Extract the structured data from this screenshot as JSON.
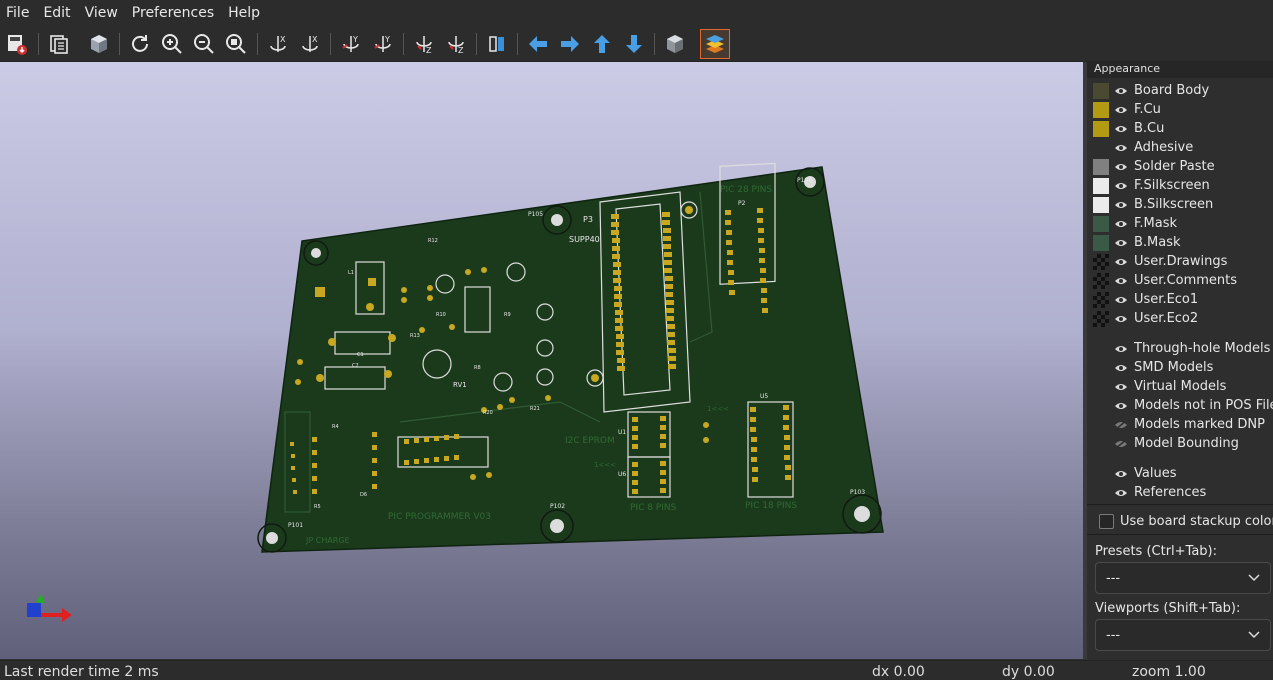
{
  "menu": [
    "File",
    "Edit",
    "View",
    "Preferences",
    "Help"
  ],
  "toolbar": {
    "icons": [
      "export-icon",
      "copy-image-icon",
      "raytrace-icon",
      "reload-icon",
      "zoom-in-icon",
      "zoom-out-icon",
      "zoom-fit-icon",
      "rotate-x-cw-icon",
      "rotate-x-ccw-icon",
      "rotate-y-cw-icon",
      "rotate-y-ccw-icon",
      "rotate-z-cw-icon",
      "rotate-z-ccw-icon",
      "flip-board-icon",
      "move-left-icon",
      "move-right-icon",
      "move-up-icon",
      "move-down-icon",
      "ortho-icon",
      "layers-manager-icon"
    ]
  },
  "board": {
    "labels": [
      "P3",
      "SUPP40",
      "PIC 28 PINS",
      "P104",
      "P105",
      "P101",
      "P102",
      "P103",
      "RV1",
      "U1",
      "U6",
      "U5",
      "PIC 8 PINS",
      "PIC 18 PINS",
      "I2C EPROM",
      "PIC PROGRAMMER V03",
      "JP CHARGE",
      "P2",
      "R12",
      "R10",
      "R13",
      "R20",
      "R21",
      "R9",
      "R8",
      "D6",
      "R4",
      "R5",
      "C1",
      "C2",
      "L1",
      "1<<<",
      "1<<<"
    ]
  },
  "panel": {
    "title": "Appearance",
    "layers": [
      {
        "label": "Board Body",
        "color": "#4a4a30"
      },
      {
        "label": "F.Cu",
        "color": "#b39a13"
      },
      {
        "label": "B.Cu",
        "color": "#b39a13"
      },
      {
        "label": "Adhesive",
        "color": ""
      },
      {
        "label": "Solder Paste",
        "color": "#808080"
      },
      {
        "label": "F.Silkscreen",
        "color": "#ebebeb"
      },
      {
        "label": "B.Silkscreen",
        "color": "#ebebeb"
      },
      {
        "label": "F.Mask",
        "color": "#3b5a45"
      },
      {
        "label": "B.Mask",
        "color": "#3b5a45"
      },
      {
        "label": "User.Drawings",
        "color": "checker"
      },
      {
        "label": "User.Comments",
        "color": "checker"
      },
      {
        "label": "User.Eco1",
        "color": "checker"
      },
      {
        "label": "User.Eco2",
        "color": "checker"
      }
    ],
    "models": [
      "Through-hole Models",
      "SMD Models",
      "Virtual Models",
      "Models not in POS File",
      "Models marked DNP",
      "Model Bounding"
    ],
    "extras": [
      "Values",
      "References"
    ],
    "stackup_label": "Use board stackup colors",
    "presets_label": "Presets (Ctrl+Tab):",
    "presets_value": "---",
    "viewports_label": "Viewports (Shift+Tab):",
    "viewports_value": "---"
  },
  "status": {
    "render_time": "Last render time 2 ms",
    "dx": "dx 0.00",
    "dy": "dy 0.00",
    "zoom": "zoom 1.00"
  }
}
